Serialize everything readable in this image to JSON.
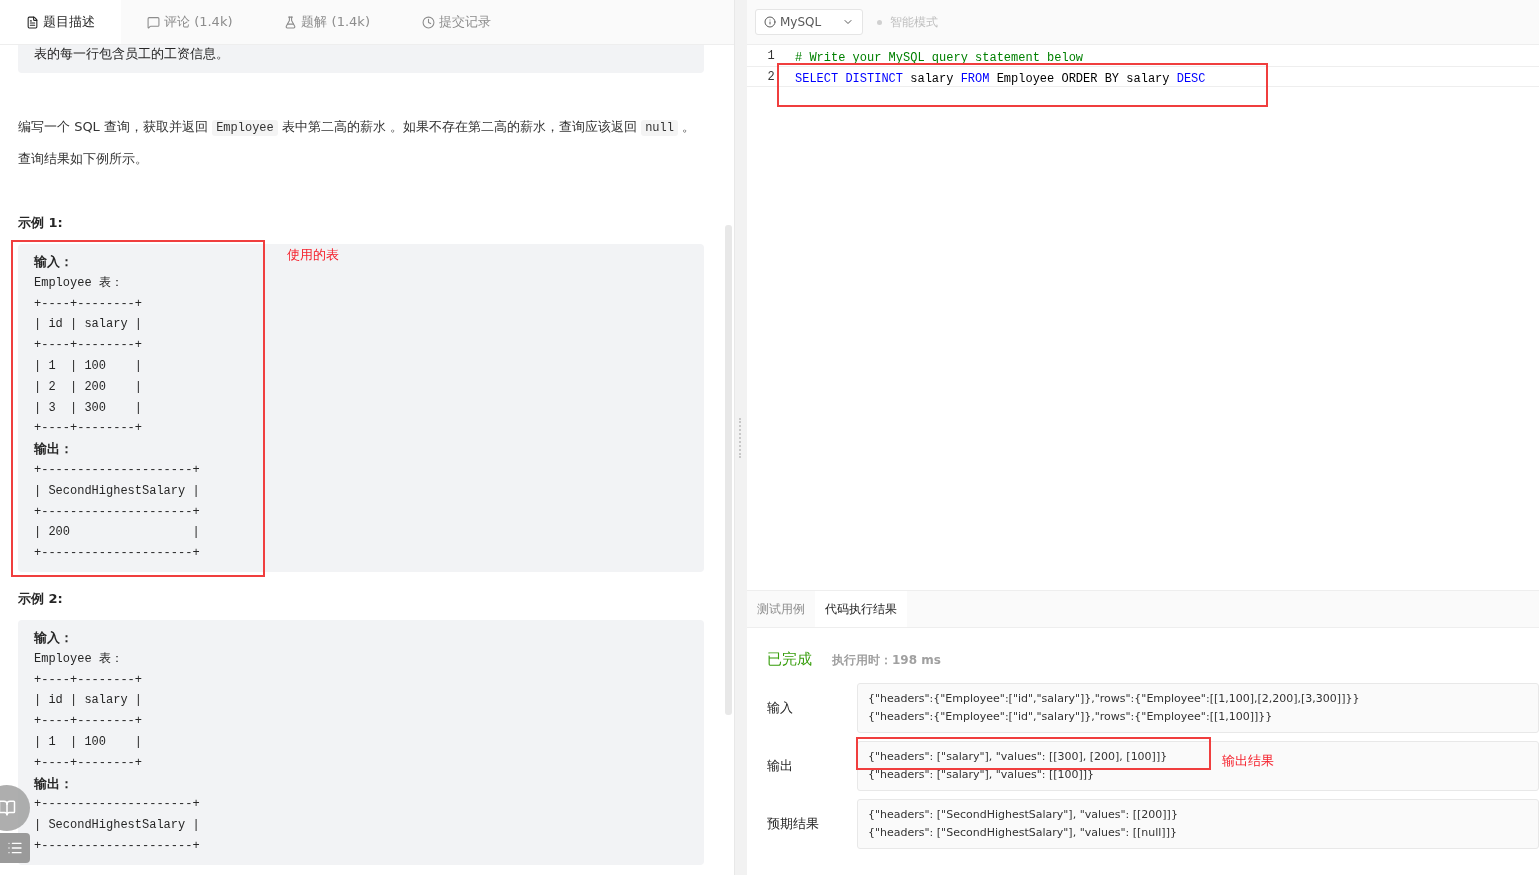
{
  "left_tabs": [
    {
      "label": "题目描述",
      "selected": true
    },
    {
      "label": "评论 (1.4k)",
      "selected": false
    },
    {
      "label": "题解 (1.4k)",
      "selected": false
    },
    {
      "label": "提交记录",
      "selected": false
    }
  ],
  "schema_note": "表的每一行包含员工的工资信息。",
  "problem_text": [
    {
      "text": "编写一个 SQL 查询，获取并返回 ",
      "kind": "text"
    },
    {
      "text": "Employee",
      "kind": "code"
    },
    {
      "text": " 表中第二高的薪水 。如果不存在第二高的薪水，查询应该返回 ",
      "kind": "text"
    },
    {
      "text": "null",
      "kind": "code"
    },
    {
      "text": " 。",
      "kind": "text"
    }
  ],
  "result_hint": "查询结果如下例所示。",
  "examples": [
    {
      "title": "示例 1:",
      "annotation": "使用的表",
      "lines": [
        {
          "kind": "label",
          "text": "输入："
        },
        {
          "kind": "code",
          "text": "Employee 表："
        },
        {
          "kind": "code",
          "text": "+----+--------+"
        },
        {
          "kind": "code",
          "text": "| id | salary |"
        },
        {
          "kind": "code",
          "text": "+----+--------+"
        },
        {
          "kind": "code",
          "text": "| 1  | 100    |"
        },
        {
          "kind": "code",
          "text": "| 2  | 200    |"
        },
        {
          "kind": "code",
          "text": "| 3  | 300    |"
        },
        {
          "kind": "code",
          "text": "+----+--------+"
        },
        {
          "kind": "label",
          "text": "输出："
        },
        {
          "kind": "code",
          "text": "+---------------------+"
        },
        {
          "kind": "code",
          "text": "| SecondHighestSalary |"
        },
        {
          "kind": "code",
          "text": "+---------------------+"
        },
        {
          "kind": "code",
          "text": "| 200                 |"
        },
        {
          "kind": "code",
          "text": "+---------------------+"
        }
      ]
    },
    {
      "title": "示例 2:",
      "lines": [
        {
          "kind": "label",
          "text": "输入："
        },
        {
          "kind": "code",
          "text": "Employee 表："
        },
        {
          "kind": "code",
          "text": "+----+--------+"
        },
        {
          "kind": "code",
          "text": "| id | salary |"
        },
        {
          "kind": "code",
          "text": "+----+--------+"
        },
        {
          "kind": "code",
          "text": "| 1  | 100    |"
        },
        {
          "kind": "code",
          "text": "+----+--------+"
        },
        {
          "kind": "label",
          "text": "输出："
        },
        {
          "kind": "code",
          "text": "+---------------------+"
        },
        {
          "kind": "code",
          "text": "| SecondHighestSalary |"
        },
        {
          "kind": "code",
          "text": "+---------------------+"
        }
      ]
    }
  ],
  "editor": {
    "language": "MySQL",
    "mode_label": "智能模式",
    "lines": [
      {
        "number": "1",
        "tokens": [
          {
            "text": "# Write your MySQL query statement below",
            "kind": "comment"
          }
        ]
      },
      {
        "number": "2",
        "tokens": [
          {
            "text": "SELECT DISTINCT",
            "kind": "keyword"
          },
          {
            "text": " salary ",
            "kind": "plain"
          },
          {
            "text": "FROM",
            "kind": "keyword"
          },
          {
            "text": " Employee ORDER BY salary ",
            "kind": "plain"
          },
          {
            "text": "DESC",
            "kind": "keyword"
          }
        ]
      }
    ]
  },
  "result_tabs": [
    {
      "label": "测试用例",
      "selected": false
    },
    {
      "label": "代码执行结果",
      "selected": true
    }
  ],
  "result": {
    "status": "已完成",
    "runtime": "执行用时：198 ms",
    "rows": [
      {
        "label": "输入",
        "lines": [
          "{\"headers\":{\"Employee\":[\"id\",\"salary\"]},\"rows\":{\"Employee\":[[1,100],[2,200],[3,300]]}}",
          "{\"headers\":{\"Employee\":[\"id\",\"salary\"]},\"rows\":{\"Employee\":[[1,100]]}}"
        ]
      },
      {
        "label": "输出",
        "annotation": "输出结果",
        "lines": [
          "{\"headers\": [\"salary\"], \"values\": [[300], [200], [100]]}",
          "{\"headers\": [\"salary\"], \"values\": [[100]]}"
        ]
      },
      {
        "label": "预期结果",
        "lines": [
          "{\"headers\": [\"SecondHighestSalary\"], \"values\": [[200]]}",
          "{\"headers\": [\"SecondHighestSalary\"], \"values\": [[null]]}"
        ]
      }
    ]
  }
}
